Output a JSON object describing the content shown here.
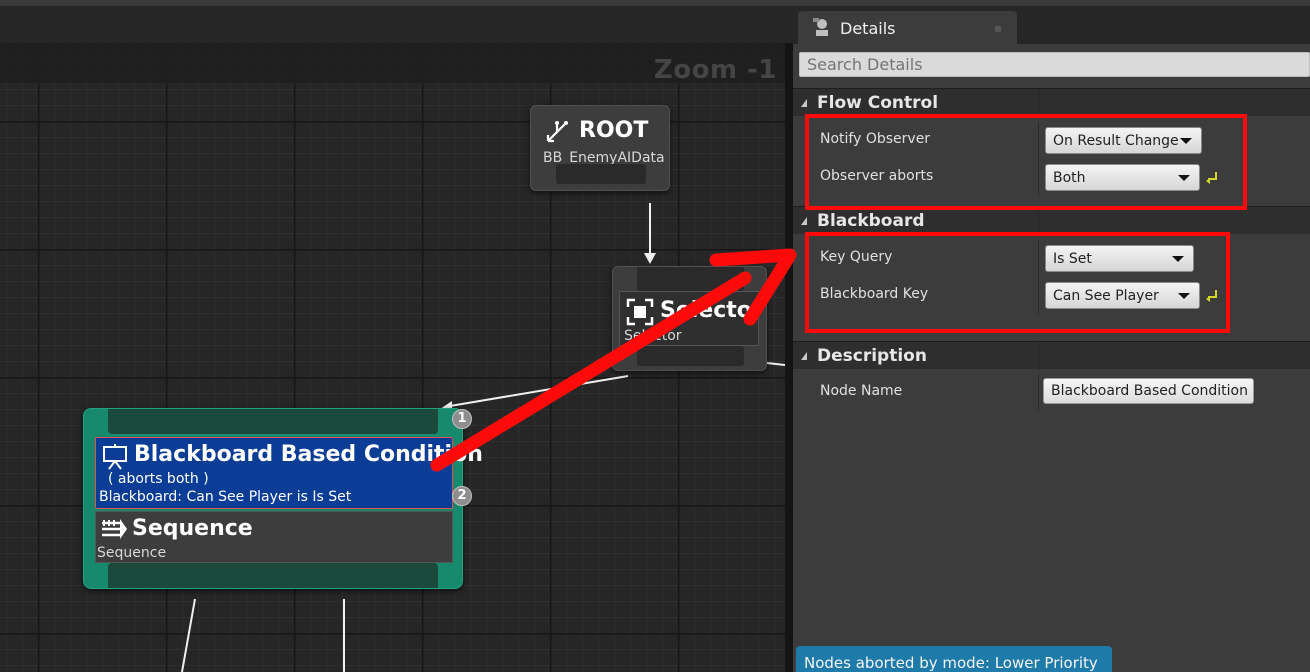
{
  "graph": {
    "zoom_label": "Zoom -1",
    "root": {
      "title": "ROOT",
      "subtitle": "BB_EnemyAIData"
    },
    "selector": {
      "title": "Selector",
      "subtitle": "Selector"
    },
    "decorator": {
      "title": "Blackboard Based Condition",
      "line1": "( aborts both )",
      "line2": "Blackboard: Can See Player is Is Set"
    },
    "sequence": {
      "title": "Sequence",
      "subtitle": "Sequence"
    },
    "badges": [
      "1",
      "2"
    ]
  },
  "details": {
    "tab_label": "Details",
    "search_placeholder": "Search Details",
    "categories": [
      {
        "label": "Flow Control",
        "rows": [
          {
            "name": "Notify Observer",
            "value": "On Result Change"
          },
          {
            "name": "Observer aborts",
            "value": "Both"
          }
        ]
      },
      {
        "label": "Blackboard",
        "rows": [
          {
            "name": "Key Query",
            "value": "Is Set"
          },
          {
            "name": "Blackboard Key",
            "value": "Can See Player"
          }
        ]
      },
      {
        "label": "Description",
        "rows": [
          {
            "name": "Node Name",
            "value": "Blackboard Based Condition"
          }
        ]
      }
    ],
    "status_text": "Nodes aborted by mode: Lower Priority"
  },
  "colors": {
    "decorator_bg": "#0b3c96",
    "composite_bg": "#17896d",
    "annotation_red": "#ff0a0a",
    "status_chip": "#1e7aa8"
  }
}
